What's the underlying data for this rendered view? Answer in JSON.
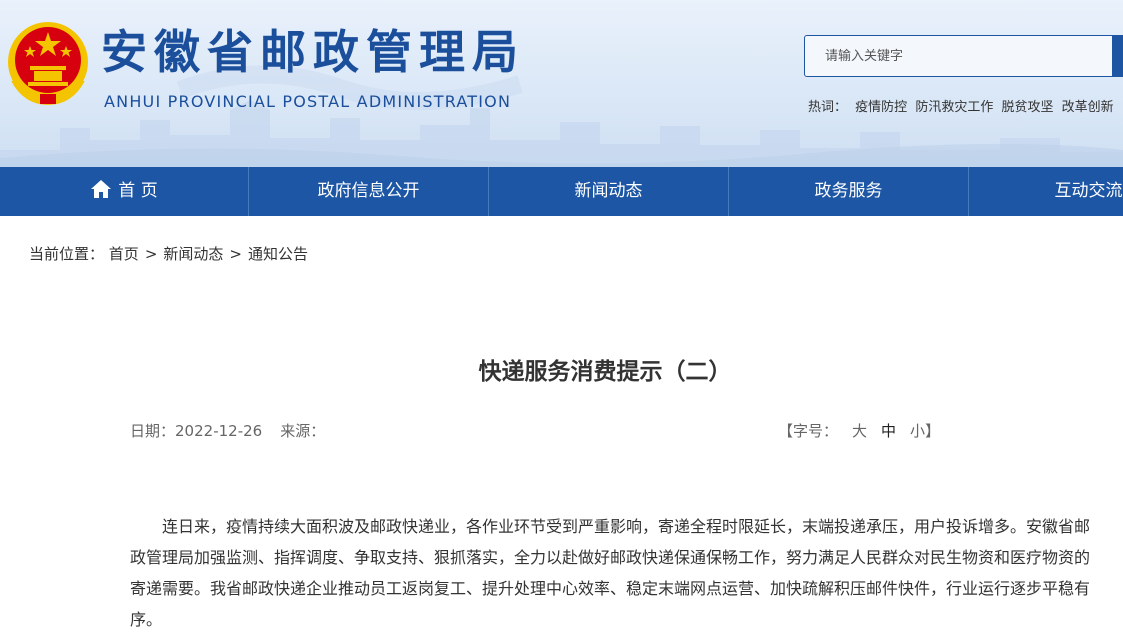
{
  "header": {
    "title": "安徽省邮政管理局",
    "subtitle": "ANHUI PROVINCIAL POSTAL ADMINISTRATION",
    "emblem_icon": "national-emblem-icon"
  },
  "search": {
    "placeholder": "请输入关键字"
  },
  "hot": {
    "label": "热词：",
    "keywords": [
      "疫情防控",
      "防汛救灾工作",
      "脱贫攻坚",
      "改革创新"
    ]
  },
  "nav": {
    "items": [
      {
        "label": "首 页",
        "icon": "home-icon"
      },
      {
        "label": "政府信息公开"
      },
      {
        "label": "新闻动态"
      },
      {
        "label": "政务服务"
      },
      {
        "label": "互动交流"
      }
    ]
  },
  "breadcrumb": {
    "prefix": "当前位置：",
    "items": [
      "首页",
      "新闻动态",
      "通知公告"
    ],
    "separator": ">"
  },
  "article": {
    "title": "快递服务消费提示（二）",
    "date_label": "日期：",
    "date": "2022-12-26",
    "source_label": "来源：",
    "source": "",
    "fontsize_open": "【字号：",
    "fontsize_options": [
      "大",
      "中",
      "小"
    ],
    "fontsize_close": "】",
    "body": "连日来，疫情持续大面积波及邮政快递业，各作业环节受到严重影响，寄递全程时限延长，末端投递承压，用户投诉增多。安徽省邮政管理局加强监测、指挥调度、争取支持、狠抓落实，全力以赴做好邮政快递保通保畅工作，努力满足人民群众对民生物资和医疗物资的寄递需要。我省邮政快递企业推动员工返岗复工、提升处理中心效率、稳定末端网点运营、加快疏解积压邮件快件，行业运行逐步平稳有序。"
  },
  "colors": {
    "brand_blue": "#1d56a4",
    "title_blue": "#1b4f9c",
    "emblem_red": "#d7000f",
    "emblem_gold": "#f5c400"
  }
}
